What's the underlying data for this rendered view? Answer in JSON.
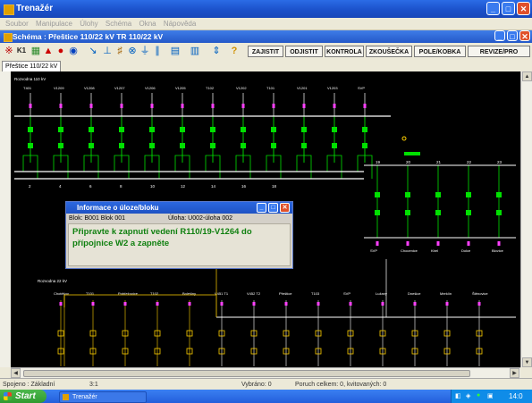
{
  "window": {
    "title": "Trenažér",
    "buttons": {
      "minimize": "_",
      "maximize": "□",
      "close": "✕"
    }
  },
  "menubar": [
    "Soubor",
    "Manipulace",
    "Úlohy",
    "Schéma",
    "Okna",
    "Nápověda"
  ],
  "child_window": {
    "title": "Schéma : Přeštice 110/22 kV   TR 110/22 kV"
  },
  "toolbar": {
    "buttons": [
      "ZAJISTIT",
      "ODJISTIT",
      "KONTROLA",
      "ZKOUŠEČKA",
      "POLE/KOBKA",
      "REVIZE/PRO"
    ],
    "help": "?"
  },
  "tab": {
    "label": "Přeštice 110/22 kV"
  },
  "diagram": {
    "label_top": "Rozvodna 110 kV",
    "label_mid": "Rozvodna 22 kV",
    "label_bottom": "Rozvodna 22 kV",
    "bays_top": [
      "T401",
      "V1209",
      "V1208",
      "V1207",
      "V1206",
      "V1205",
      "T102",
      "V1202",
      "T101",
      "V1201",
      "V1203",
      "SVP"
    ],
    "bays_bottom": [
      "Chotěšov",
      "T101",
      "Pobřežovice",
      "T102",
      "Bolešiny",
      "V451 T1",
      "V452 T2",
      "Přeštice",
      "T103",
      "SVP",
      "Lužany",
      "Dnešice",
      "Merklín",
      "Štěnovice"
    ],
    "bays_right": [
      "SVP",
      "Chocenice",
      "Kbel",
      "Dolce",
      "Blovice"
    ],
    "nums_top": [
      "2",
      "4",
      "6",
      "8",
      "10",
      "12",
      "14",
      "16",
      "18"
    ],
    "nums_right": [
      "19",
      "20",
      "21",
      "22",
      "23"
    ]
  },
  "dialog": {
    "title": "Informace o úloze/bloku",
    "block": "Blok: B001 Blok 001",
    "task": "Úloha: U002-úloha 002",
    "message": "Připravte k zapnutí vedení R110/19-V1264 do přípojnice W2 a zapněte"
  },
  "statusbar": {
    "connection": "Spojeno : Základní",
    "scale": "3:1",
    "selected": "Vybráno: 0",
    "faults": "Poruch celkem: 0, kvitovaných: 0"
  },
  "taskbar": {
    "start": "Start",
    "task": "Trenažér",
    "clock": "14:0"
  },
  "colors": {
    "canvas": "#000000",
    "busbar": "#ffffff",
    "active": "#00e000",
    "inactive": "#ffd000",
    "breaker_mark": "#ff40ff",
    "message": "#108010"
  }
}
